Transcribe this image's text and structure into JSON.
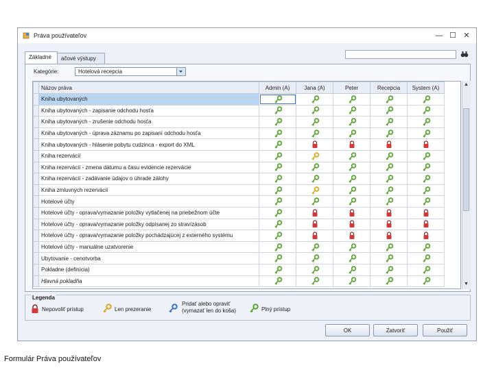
{
  "window": {
    "title": "Práva používateľov",
    "minimize_glyph": "—",
    "maximize_glyph": "☐",
    "close_glyph": "✕"
  },
  "tabs": [
    {
      "label": "Základné"
    },
    {
      "label": "ačové výstupy"
    }
  ],
  "search": {
    "value": "",
    "icon": "binoculars-icon"
  },
  "category": {
    "label": "Kategórie:",
    "value": "Hotelová recepcia"
  },
  "grid": {
    "name_header": "Názov práva",
    "columns": [
      "Admin (A)",
      "Jana (A)",
      "Peter",
      "Recepcia",
      "System (A)"
    ],
    "rows": [
      {
        "name": "Kniha ubytovaných",
        "perms": [
          "full-blue",
          "full",
          "full",
          "full",
          "full"
        ]
      },
      {
        "name": "Kniha ubytovaných - zapisanie odchodu hosťa",
        "perms": [
          "full",
          "full",
          "full",
          "full",
          "full"
        ]
      },
      {
        "name": "Kniha ubytovaných - zrušenie odchodu hosťa",
        "perms": [
          "full",
          "full",
          "full",
          "full",
          "full"
        ]
      },
      {
        "name": "Kniha ubytovaných - úprava záznamu po zapisaní odchodu hosťa",
        "perms": [
          "full",
          "full",
          "full",
          "full",
          "full"
        ]
      },
      {
        "name": "Kniha ubytovaných - hlásenie pobytu cudzinca - export do XML",
        "perms": [
          "full",
          "lock",
          "lock",
          "lock",
          "lock"
        ]
      },
      {
        "name": "Kniha rezervácií",
        "perms": [
          "full",
          "view",
          "full",
          "full",
          "full"
        ]
      },
      {
        "name": "Kniha rezervácií - zmena dátumu a času evidencie rezervácie",
        "perms": [
          "full",
          "full",
          "full",
          "full",
          "full"
        ]
      },
      {
        "name": "Kniha rezervácií - zadávanie údajov o úhrade zálohy",
        "perms": [
          "full",
          "full",
          "full",
          "full",
          "full"
        ]
      },
      {
        "name": "Kniha zmluvných rezervácií",
        "perms": [
          "full",
          "view",
          "full",
          "full",
          "full"
        ]
      },
      {
        "name": "Hotelové účty",
        "perms": [
          "full",
          "full",
          "full",
          "full",
          "full"
        ]
      },
      {
        "name": "Hotelové účty - oprava/vymazanie položky vytlačenej na priebežnom účte",
        "perms": [
          "full",
          "lock",
          "lock",
          "lock",
          "lock"
        ]
      },
      {
        "name": "Hotelové účty - oprava/vymazanie položky odpísanej zo stravízásob",
        "perms": [
          "full",
          "lock",
          "lock",
          "lock",
          "lock"
        ]
      },
      {
        "name": "Hotelové účty - oprava/vymazanie položky pochádzajúcej z externého systému",
        "perms": [
          "full",
          "lock",
          "lock",
          "lock",
          "lock"
        ]
      },
      {
        "name": "Hotelové účty - manuálne uzatvorenie",
        "perms": [
          "full",
          "full",
          "full",
          "full",
          "full"
        ]
      },
      {
        "name": "Ubytovanie - cenotvorba",
        "perms": [
          "full",
          "full",
          "full",
          "full",
          "full"
        ]
      },
      {
        "name": "Pokladne (definícia)",
        "perms": [
          "full",
          "full",
          "full",
          "full",
          "full"
        ]
      },
      {
        "name": "Hlavná pokladňa",
        "perms": [
          "full",
          "full",
          "full",
          "full",
          "full"
        ],
        "italic": true
      }
    ]
  },
  "legend": {
    "title": "Legenda",
    "items": [
      {
        "label": "Nepovoliť prístup",
        "icon": "lock-icon"
      },
      {
        "label": "Len prezeranie",
        "icon": "yellow-key-icon"
      },
      {
        "label_line1": "Pridať alebo opraviť",
        "label_line2": "(vymazať len do koša)",
        "icon": "blue-key-icon"
      },
      {
        "label": "Plný prístup",
        "icon": "green-key-icon"
      }
    ]
  },
  "buttons": {
    "ok": "OK",
    "close": "Zatvoriť",
    "apply": "Použiť"
  },
  "caption": "Formulár Práva používateľov",
  "colors": {
    "green": "#5aa532",
    "yellow": "#d9a820",
    "blue": "#3d6fc9",
    "lock": "#d23a3a"
  }
}
